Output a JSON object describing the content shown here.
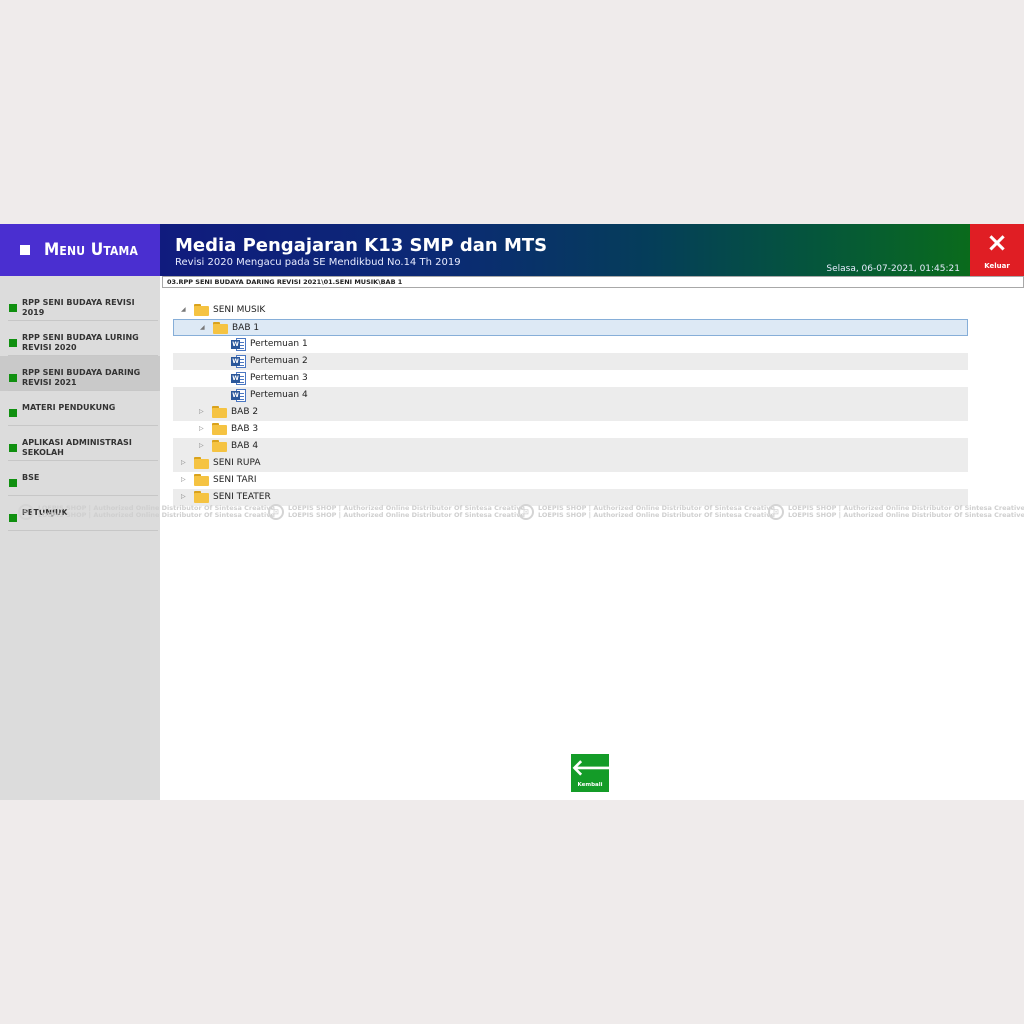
{
  "header": {
    "menu_label": "Menu Utama",
    "title": "Media Pengajaran K13 SMP dan MTS",
    "subtitle": "Revisi 2020 Mengacu pada SE Mendikbud No.14 Th 2019",
    "datetime": "Selasa, 06-07-2021, 01:45:21",
    "exit_icon": "×",
    "exit_label": "Keluar"
  },
  "sidebar": {
    "items": [
      {
        "label": "RPP SENI BUDAYA REVISI 2019"
      },
      {
        "label": "RPP SENI BUDAYA LURING REVISI 2020"
      },
      {
        "label": "RPP SENI BUDAYA DARING REVISI 2021"
      },
      {
        "label": "MATERI PENDUKUNG"
      },
      {
        "label": "APLIKASI ADMINISTRASI SEKOLAH"
      },
      {
        "label": "BSE"
      },
      {
        "label": "PETUNJUK"
      }
    ],
    "active_index": 2
  },
  "path": "03.RPP SENI BUDAYA DARING REVISI 2021\\01.SENI MUSIK\\BAB 1",
  "tree": [
    {
      "label": "SENI MUSIK",
      "type": "folder",
      "expanded": true
    },
    {
      "label": "BAB 1",
      "type": "folder",
      "expanded": true,
      "selected": true
    },
    {
      "label": "Pertemuan 1",
      "type": "word"
    },
    {
      "label": "Pertemuan 2",
      "type": "word"
    },
    {
      "label": "Pertemuan 3",
      "type": "word"
    },
    {
      "label": "Pertemuan 4",
      "type": "word"
    },
    {
      "label": "BAB 2",
      "type": "folder",
      "expanded": false
    },
    {
      "label": "BAB 3",
      "type": "folder",
      "expanded": false
    },
    {
      "label": "BAB 4",
      "type": "folder",
      "expanded": false
    },
    {
      "label": "SENI RUPA",
      "type": "folder",
      "expanded": false
    },
    {
      "label": "SENI TARI",
      "type": "folder",
      "expanded": false
    },
    {
      "label": "SENI TEATER",
      "type": "folder",
      "expanded": false
    }
  ],
  "watermark": {
    "line1": "LOEPIS SHOP | Authorized Online Distributor Of Sintesa Creative",
    "line2": "LOEPIS SHOP | Authorized Online Distributor Of Sintesa Creative"
  },
  "back": {
    "icon": "🡐",
    "label": "Kembali"
  },
  "colors": {
    "menu_head": "#4a2fd0",
    "exit": "#e01e24",
    "bullet": "#109010",
    "back_button": "#149c28",
    "word_icon": "#2b579a",
    "folder_icon": "#f5c342"
  }
}
